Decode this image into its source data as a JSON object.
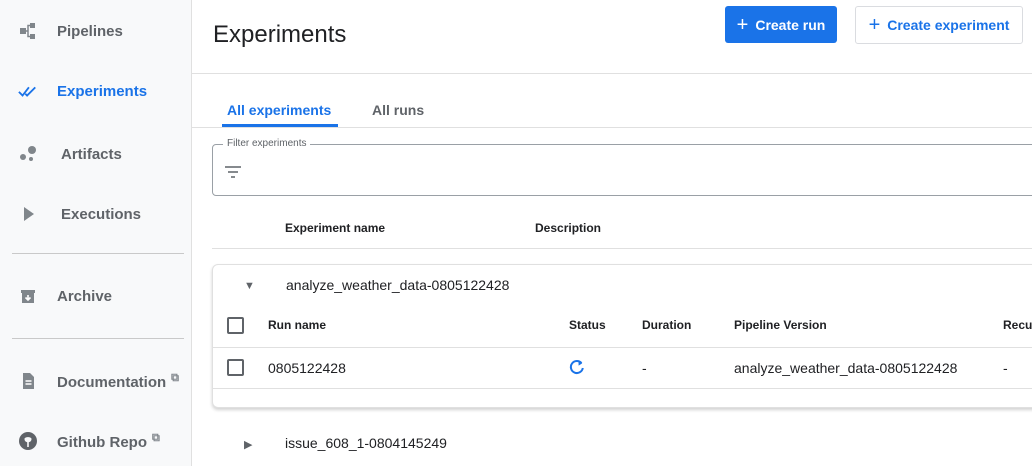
{
  "sidebar": {
    "items": [
      {
        "label": "Pipelines",
        "icon": "pipelines-icon"
      },
      {
        "label": "Experiments",
        "icon": "experiments-icon",
        "active": true
      },
      {
        "label": "Artifacts",
        "icon": "artifacts-icon"
      },
      {
        "label": "Executions",
        "icon": "executions-icon"
      },
      {
        "label": "Archive",
        "icon": "archive-icon"
      },
      {
        "label": "Documentation",
        "icon": "documentation-icon",
        "external": true
      },
      {
        "label": "Github Repo",
        "icon": "github-icon",
        "external": true
      }
    ],
    "external_glyph": "⧉"
  },
  "header": {
    "title": "Experiments",
    "create_run_label": "Create run",
    "create_experiment_label": "Create experiment",
    "plus_glyph": "+"
  },
  "tabs": [
    {
      "label": "All experiments",
      "active": true
    },
    {
      "label": "All runs"
    }
  ],
  "filter": {
    "label": "Filter experiments",
    "value": ""
  },
  "experiments_table": {
    "columns": [
      "Experiment name",
      "Description"
    ],
    "expanded": {
      "name": "analyze_weather_data-0805122428",
      "runs_columns": [
        "Run name",
        "Status",
        "Duration",
        "Pipeline Version",
        "Recu"
      ],
      "runs": [
        {
          "name": "0805122428",
          "status": "running",
          "duration": "-",
          "pipeline_version": "analyze_weather_data-0805122428",
          "recurring": "-"
        }
      ]
    },
    "collapsed": [
      {
        "name": "issue_608_1-0804145249"
      }
    ]
  },
  "colors": {
    "accent": "#1a73e8",
    "sidebar_bg": "#f8f9fa",
    "text_secondary": "#5f6368"
  }
}
